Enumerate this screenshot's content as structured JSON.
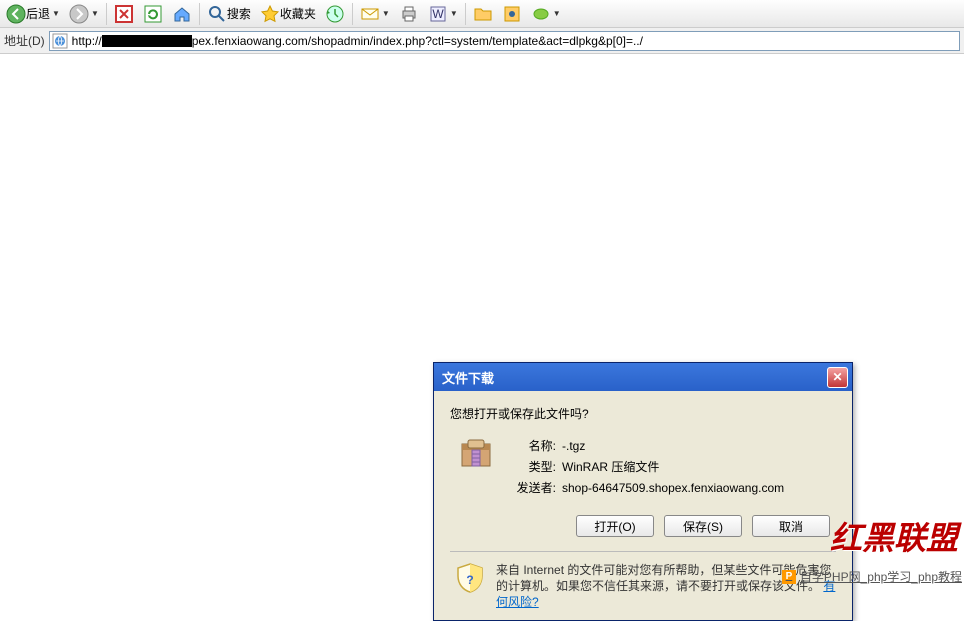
{
  "toolbar": {
    "back_label": "后退",
    "search_label": "搜索",
    "favorites_label": "收藏夹"
  },
  "addr": {
    "label": "地址(D)",
    "url_suffix": "pex.fenxiaowang.com/shopadmin/index.php?ctl=system/template&act=dlpkg&p[0]=../"
  },
  "dialog": {
    "title": "文件下载",
    "question": "您想打开或保存此文件吗?",
    "name_label": "名称:",
    "name_value": "-.tgz",
    "type_label": "类型:",
    "type_value": "WinRAR 压缩文件",
    "sender_label": "发送者:",
    "sender_value": "shop-64647509.shopex.fenxiaowang.com",
    "btn_open": "打开(O)",
    "btn_save": "保存(S)",
    "btn_cancel": "取消",
    "warn_text_1": "来自 Internet 的文件可能对您有所帮助，但某些文件可能危害您的计算机。如果您不信任其来源，请不要打开或保存该文件。",
    "warn_link": "有何风险?"
  },
  "watermark": "红黑联盟",
  "bottom_link": "自学PHP网_php学习_php教程"
}
